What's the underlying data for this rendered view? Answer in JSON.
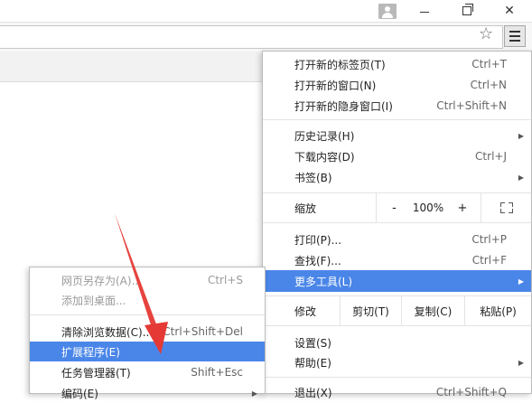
{
  "titlebar": {
    "controls": [
      "user-icon",
      "minimize-icon",
      "restore-icon",
      "close-icon"
    ],
    "close_glyph": "✕"
  },
  "toolbar": {
    "star_glyph": "☆",
    "menu_icon": "hamburger-menu-icon"
  },
  "main_menu": {
    "new_tab": {
      "label": "打开新的标签页(T)",
      "shortcut": "Ctrl+T"
    },
    "new_window": {
      "label": "打开新的窗口(N)",
      "shortcut": "Ctrl+N"
    },
    "new_incognito": {
      "label": "打开新的隐身窗口(I)",
      "shortcut": "Ctrl+Shift+N"
    },
    "history": {
      "label": "历史记录(H)"
    },
    "downloads": {
      "label": "下载内容(D)",
      "shortcut": "Ctrl+J"
    },
    "bookmarks": {
      "label": "书签(B)"
    },
    "zoom": {
      "label": "缩放",
      "minus": "-",
      "value": "100%",
      "plus": "+"
    },
    "print": {
      "label": "打印(P)...",
      "shortcut": "Ctrl+P"
    },
    "find": {
      "label": "查找(F)...",
      "shortcut": "Ctrl+F"
    },
    "more_tools": {
      "label": "更多工具(L)"
    },
    "edit": {
      "label": "修改",
      "cut": "剪切(T)",
      "copy": "复制(C)",
      "paste": "粘贴(P)"
    },
    "settings": {
      "label": "设置(S)"
    },
    "help": {
      "label": "帮助(E)"
    },
    "exit": {
      "label": "退出(X)",
      "shortcut": "Ctrl+Shift+Q"
    }
  },
  "sub_menu": {
    "save_page": {
      "label": "网页另存为(A)...",
      "shortcut": "Ctrl+S"
    },
    "add_to_desktop": {
      "label": "添加到桌面..."
    },
    "clear_data": {
      "label": "清除浏览数据(C)...",
      "shortcut": "Ctrl+Shift+Del"
    },
    "extensions": {
      "label": "扩展程序(E)"
    },
    "task_manager": {
      "label": "任务管理器(T)",
      "shortcut": "Shift+Esc"
    },
    "encoding": {
      "label": "编码(E)"
    }
  },
  "colors": {
    "highlight": "#4a86e8",
    "annotation_arrow": "#e53935"
  }
}
